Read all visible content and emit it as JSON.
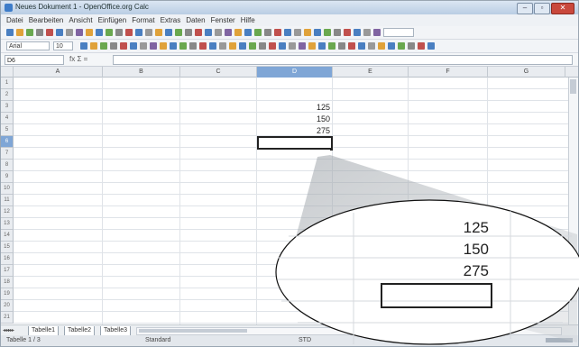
{
  "window": {
    "title": "Neues Dokument 1 - OpenOffice.org Calc"
  },
  "menu": [
    "Datei",
    "Bearbeiten",
    "Ansicht",
    "Einfügen",
    "Format",
    "Extras",
    "Daten",
    "Fenster",
    "Hilfe"
  ],
  "toolbar": {
    "font_name": "Arial",
    "font_size": "10",
    "zoom_box": ""
  },
  "formula": {
    "name_box": "D6",
    "fx_label": "fx Σ =",
    "input_value": ""
  },
  "columns": [
    "A",
    "B",
    "C",
    "D",
    "E",
    "F",
    "G"
  ],
  "selected_column": "D",
  "rows": [
    "1",
    "2",
    "3",
    "4",
    "5",
    "6",
    "7",
    "8",
    "9",
    "10",
    "11",
    "12",
    "13",
    "14",
    "15",
    "16",
    "17",
    "18",
    "19",
    "20",
    "21"
  ],
  "selected_row": "6",
  "cells": {
    "D3": "125",
    "D4": "150",
    "D5": "275"
  },
  "sheets": [
    "Tabelle1",
    "Tabelle2",
    "Tabelle3"
  ],
  "status": {
    "sheet": "Tabelle 1 / 3",
    "style": "Standard",
    "mode": "STD"
  },
  "magnified": {
    "values": [
      "125",
      "150",
      "275"
    ]
  },
  "colors": {
    "selection_header": "#7fa6d6",
    "title_gradient_top": "#dbe6f3",
    "close_button": "#c9483c"
  }
}
